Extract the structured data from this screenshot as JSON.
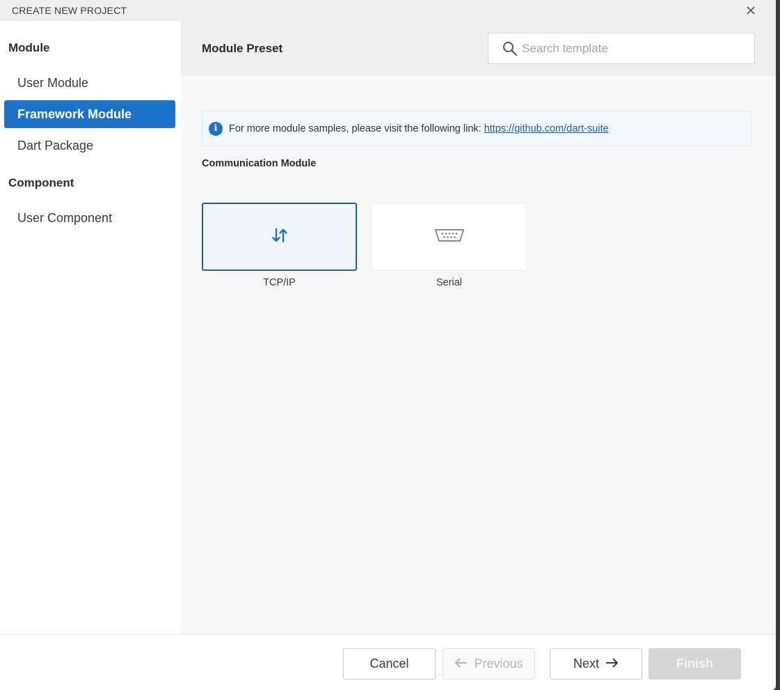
{
  "dialog": {
    "title": "CREATE NEW PROJECT"
  },
  "sidebar": {
    "module_heading": "Module",
    "module_items": [
      {
        "label": "User Module",
        "active": false
      },
      {
        "label": "Framework Module",
        "active": true
      },
      {
        "label": "Dart Package",
        "active": false
      }
    ],
    "component_heading": "Component",
    "component_items": [
      {
        "label": "User Component",
        "active": false
      }
    ]
  },
  "main": {
    "title": "Module Preset",
    "search": {
      "placeholder": "Search template",
      "value": ""
    },
    "info": {
      "text": "For more module samples, please visit the following link: ",
      "link": "https://github.com/dart-suite"
    },
    "section_label": "Communication Module",
    "cards": [
      {
        "label": "TCP/IP",
        "icon": "transfer-arrows-icon",
        "selected": true
      },
      {
        "label": "Serial",
        "icon": "serial-port-icon",
        "selected": false
      }
    ]
  },
  "footer": {
    "cancel": "Cancel",
    "previous": "Previous",
    "next": "Next",
    "finish": "Finish"
  },
  "colors": {
    "accent": "#1a73c9",
    "selected_border": "#1a5fb0",
    "main_bg": "#f7f7f7",
    "header_bg": "#efefef"
  }
}
